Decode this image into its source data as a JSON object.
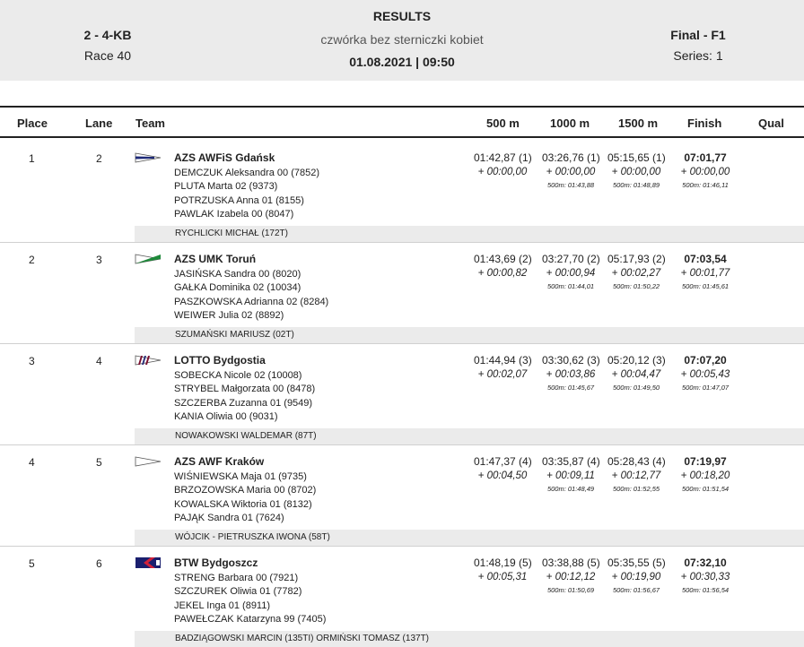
{
  "header": {
    "left_title": "2 - 4-KB",
    "left_sub": "Race 40",
    "center_title": "RESULTS",
    "center_sub": "czwórka bez sterniczki kobiet",
    "center_date": "01.08.2021 | 09:50",
    "right_title": "Final - F1",
    "right_sub": "Series: 1"
  },
  "columns": {
    "place": "Place",
    "lane": "Lane",
    "team": "Team",
    "m500": "500 m",
    "m1000": "1000 m",
    "m1500": "1500 m",
    "finish": "Finish",
    "qual": "Qual"
  },
  "entries": [
    {
      "place": "1",
      "lane": "2",
      "team": "AZS AWFiS Gdańsk",
      "flag": "gdansk-flag",
      "crew": [
        "DEMCZUK  Aleksandra 00 (7852)",
        "PLUTA  Marta 02 (9373)",
        "POTRZUSKA  Anna 01 (8155)",
        "PAWLAK  Izabela 00 (8047)"
      ],
      "coach": "RYCHLICKI MICHAŁ (172T)",
      "s500": {
        "time": "01:42,87 (1)",
        "diff": "+ 00:00,00",
        "pace": ""
      },
      "s1000": {
        "time": "03:26,76 (1)",
        "diff": "+ 00:00,00",
        "pace": "500m: 01:43,88"
      },
      "s1500": {
        "time": "05:15,65 (1)",
        "diff": "+ 00:00,00",
        "pace": "500m: 01:48,89"
      },
      "finish": {
        "time": "07:01,77",
        "diff": "+ 00:00,00",
        "pace": "500m: 01:46,11"
      }
    },
    {
      "place": "2",
      "lane": "3",
      "team": "AZS UMK Toruń",
      "flag": "torun-flag",
      "crew": [
        "JASIŃSKA  Sandra 00 (8020)",
        "GAŁKA  Dominika 02 (10034)",
        "PASZKOWSKA  Adrianna 02 (8284)",
        "WEIWER  Julia 02 (8892)"
      ],
      "coach": "SZUMAŃSKI MARIUSZ (02T)",
      "s500": {
        "time": "01:43,69 (2)",
        "diff": "+ 00:00,82",
        "pace": ""
      },
      "s1000": {
        "time": "03:27,70 (2)",
        "diff": "+ 00:00,94",
        "pace": "500m: 01:44,01"
      },
      "s1500": {
        "time": "05:17,93 (2)",
        "diff": "+ 00:02,27",
        "pace": "500m: 01:50,22"
      },
      "finish": {
        "time": "07:03,54",
        "diff": "+ 00:01,77",
        "pace": "500m: 01:45,61"
      }
    },
    {
      "place": "3",
      "lane": "4",
      "team": "LOTTO Bydgostia",
      "flag": "bydgostia-flag",
      "crew": [
        "SOBECKA  Nicole 02 (10008)",
        "STRYBEL  Małgorzata 00 (8478)",
        "SZCZERBA  Zuzanna 01 (9549)",
        "KANIA  Oliwia 00 (9031)"
      ],
      "coach": "NOWAKOWSKI WALDEMAR (87T)",
      "s500": {
        "time": "01:44,94 (3)",
        "diff": "+ 00:02,07",
        "pace": ""
      },
      "s1000": {
        "time": "03:30,62 (3)",
        "diff": "+ 00:03,86",
        "pace": "500m: 01:45,67"
      },
      "s1500": {
        "time": "05:20,12 (3)",
        "diff": "+ 00:04,47",
        "pace": "500m: 01:49,50"
      },
      "finish": {
        "time": "07:07,20",
        "diff": "+ 00:05,43",
        "pace": "500m: 01:47,07"
      }
    },
    {
      "place": "4",
      "lane": "5",
      "team": "AZS AWF Kraków",
      "flag": "krakow-flag",
      "crew": [
        "WIŚNIEWSKA  Maja 01 (9735)",
        "BRZOZOWSKA  Maria 00 (8702)",
        "KOWALSKA  Wiktoria 01 (8132)",
        "PAJĄK  Sandra 01 (7624)"
      ],
      "coach": "WÓJCIK - PIETRUSZKA IWONA (58T)",
      "s500": {
        "time": "01:47,37 (4)",
        "diff": "+ 00:04,50",
        "pace": ""
      },
      "s1000": {
        "time": "03:35,87 (4)",
        "diff": "+ 00:09,11",
        "pace": "500m: 01:48,49"
      },
      "s1500": {
        "time": "05:28,43 (4)",
        "diff": "+ 00:12,77",
        "pace": "500m: 01:52,55"
      },
      "finish": {
        "time": "07:19,97",
        "diff": "+ 00:18,20",
        "pace": "500m: 01:51,54"
      }
    },
    {
      "place": "5",
      "lane": "6",
      "team": "BTW Bydgoszcz",
      "flag": "btw-flag",
      "crew": [
        "STRENG  Barbara 00 (7921)",
        "SZCZUREK  Oliwia 01 (7782)",
        "JEKEL  Inga 01 (8911)",
        "PAWEŁCZAK  Katarzyna 99 (7405)"
      ],
      "coach": "BADZIĄGOWSKI MARCIN (135TI) ORMIŃSKI TOMASZ (137T)",
      "s500": {
        "time": "01:48,19 (5)",
        "diff": "+ 00:05,31",
        "pace": ""
      },
      "s1000": {
        "time": "03:38,88 (5)",
        "diff": "+ 00:12,12",
        "pace": "500m: 01:50,69"
      },
      "s1500": {
        "time": "05:35,55 (5)",
        "diff": "+ 00:19,90",
        "pace": "500m: 01:56,67"
      },
      "finish": {
        "time": "07:32,10",
        "diff": "+ 00:30,33",
        "pace": "500m: 01:56,54"
      }
    }
  ]
}
